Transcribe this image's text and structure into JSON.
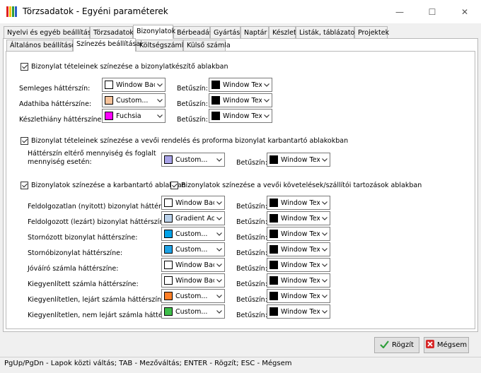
{
  "window": {
    "title": "Törzsadatok - Egyéni paraméterek",
    "minimize_glyph": "—",
    "maximize_glyph": "☐",
    "close_glyph": "✕"
  },
  "tabs": [
    {
      "label": "Nyelvi és egyéb beállítások",
      "active": false
    },
    {
      "label": "Törzsadatok",
      "active": false
    },
    {
      "label": "Bizonylatok",
      "active": true
    },
    {
      "label": "Bérbeadás",
      "active": false
    },
    {
      "label": "Gyártás",
      "active": false
    },
    {
      "label": "Naptár",
      "active": false
    },
    {
      "label": "Készlet",
      "active": false
    },
    {
      "label": "Listák, táblázatok",
      "active": false
    },
    {
      "label": "Projektek",
      "active": false
    }
  ],
  "subtabs": [
    {
      "label": "Általános beállítások",
      "active": false
    },
    {
      "label": "Színezés beállításai",
      "active": true
    },
    {
      "label": "Költségszámla",
      "active": false
    },
    {
      "label": "Külső számla",
      "active": false
    }
  ],
  "section1": {
    "checkbox_label": "Bizonylat tételeinek színezése a bizonylatkészítő ablakban",
    "checked": true,
    "rows": [
      {
        "label": "Semleges háttérszín:",
        "bg": {
          "text": "Window Back",
          "color": "#ffffff"
        },
        "fg_label": "Betűszín:",
        "fg": {
          "text": "Window Text",
          "color": "#000000"
        }
      },
      {
        "label": "Adathiba háttérszíne:",
        "bg": {
          "text": "Custom...",
          "color": "#f7c39b"
        },
        "fg_label": "Betűszín:",
        "fg": {
          "text": "Window Text",
          "color": "#000000"
        }
      },
      {
        "label": "Készlethiány háttérszíne:",
        "bg": {
          "text": "Fuchsia",
          "color": "#ff00ff"
        },
        "fg_label": "Betűszín:",
        "fg": {
          "text": "Window Text",
          "color": "#000000"
        }
      }
    ]
  },
  "section2": {
    "checkbox_label": "Bizonylat tételeinek színezése a vevői rendelés és proforma bizonylat karbantartó ablakokban",
    "checked": true,
    "row": {
      "label_line1": "Háttérszín eltérő mennyiség és foglalt",
      "label_line2": "mennyiség esetén:",
      "bg": {
        "text": "Custom...",
        "color": "#a9a3e8"
      },
      "fg_label": "Betűszín:",
      "fg": {
        "text": "Window Text",
        "color": "#000000"
      }
    }
  },
  "section3": {
    "checkbox_label_left": "Bizonylatok színezése a karbantartó ablakban",
    "checked_left": true,
    "checkbox_label_right": "Bizonylatok színezése a vevői követelések/szállítói tartozások ablakban",
    "checked_right": true,
    "rows": [
      {
        "label": "Feldolgozatlan (nyitott) bizonylat háttérszíne:",
        "bg": {
          "text": "Window Back",
          "color": "#ffffff"
        },
        "fg_label": "Betűszín:",
        "fg": {
          "text": "Window Text",
          "color": "#000000"
        }
      },
      {
        "label": "Feldolgozott (lezárt) bizonylat háttérszíne:",
        "bg": {
          "text": "Gradient Activ",
          "color": "#b9d1ea"
        },
        "fg_label": "Betűszín:",
        "fg": {
          "text": "Window Text",
          "color": "#000000"
        }
      },
      {
        "label": "Stornózott bizonylat háttérszíne:",
        "bg": {
          "text": "Custom...",
          "color": "#00a2e8"
        },
        "fg_label": "Betűszín:",
        "fg": {
          "text": "Window Text",
          "color": "#000000"
        }
      },
      {
        "label": "Stornóbizonylat háttérszíne:",
        "bg": {
          "text": "Custom...",
          "color": "#1fa3e6"
        },
        "fg_label": "Betűszín:",
        "fg": {
          "text": "Window Text",
          "color": "#000000"
        }
      },
      {
        "label": "Jóváíró számla háttérszíne:",
        "bg": {
          "text": "Window Back",
          "color": "#ffffff"
        },
        "fg_label": "Betűszín:",
        "fg": {
          "text": "Window Text",
          "color": "#000000"
        }
      },
      {
        "label": "Kiegyenlített számla háttérszíne:",
        "bg": {
          "text": "Window Back",
          "color": "#ffffff"
        },
        "fg_label": "Betűszín:",
        "fg": {
          "text": "Window Text",
          "color": "#000000"
        }
      },
      {
        "label": "Kiegyenlítetlen, lejárt számla háttérszíne:",
        "bg": {
          "text": "Custom...",
          "color": "#ff7f27"
        },
        "fg_label": "Betűszín:",
        "fg": {
          "text": "Window Text",
          "color": "#000000"
        }
      },
      {
        "label": "Kiegyenlítetlen, nem lejárt számla háttérszíne:",
        "bg": {
          "text": "Custom...",
          "color": "#3fbf4a"
        },
        "fg_label": "Betűszín:",
        "fg": {
          "text": "Window Text",
          "color": "#000000"
        }
      }
    ]
  },
  "buttons": {
    "save_label": "Rögzít",
    "cancel_label": "Mégsem"
  },
  "status": {
    "text": "PgUp/PgDn - Lapok közti váltás; TAB - Mezőváltás; ENTER - Rögzít; ESC - Mégsem"
  }
}
